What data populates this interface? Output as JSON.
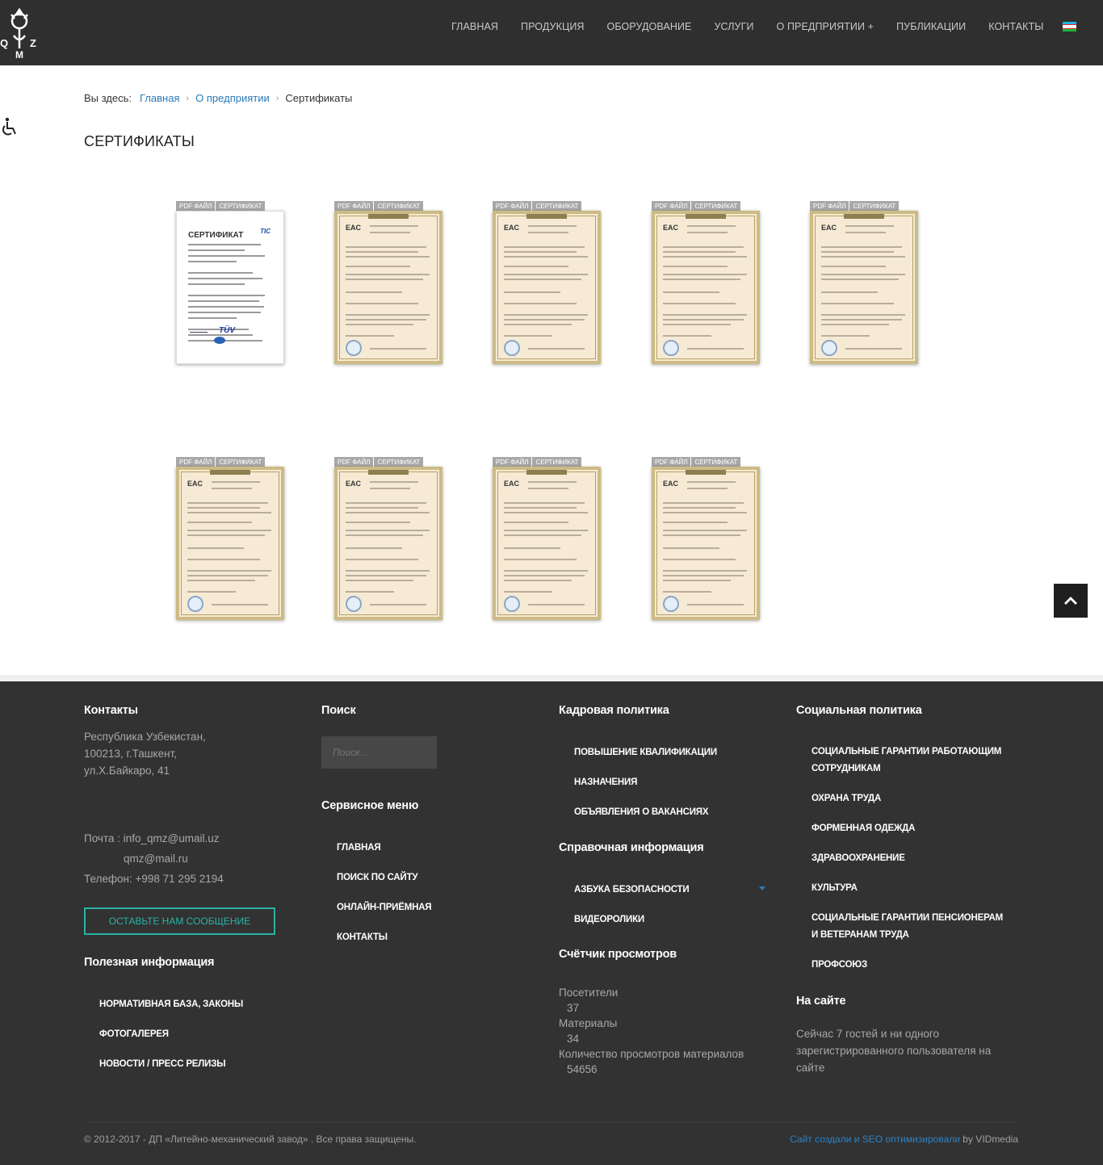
{
  "header": {
    "logo_letters": [
      "Q",
      "Z",
      "M"
    ],
    "nav": [
      "ГЛАВНАЯ",
      "ПРОДУКЦИЯ",
      "ОБОРУДОВАНИЕ",
      "УСЛУГИ",
      "О ПРЕДПРИЯТИИ +",
      "ПУБЛИКАЦИИ",
      "КОНТАКТЫ"
    ],
    "flag_icon": "uzbekistan-flag-icon"
  },
  "breadcrumb": {
    "label": "Вы здесь:",
    "items": [
      "Главная",
      "О предприятии",
      "Сертификаты"
    ],
    "separator": "›"
  },
  "page_title": "СЕРТИФИКАТЫ",
  "certificates": {
    "tag_pdf": "PDF ФАЙЛ",
    "tag_cert": "СЕРТИФИКАТ",
    "first_doc": {
      "title": "СЕРТИФИКАТ",
      "badge": "TIC",
      "logo": "TÜV"
    },
    "eac_label": "EAC",
    "count": 9
  },
  "footer": {
    "contacts": {
      "heading": "Контакты",
      "address": [
        "Республика Узбекистан,",
        "100213, г.Ташкент,",
        "ул.Х.Байкаро, 41"
      ],
      "mail_label": "Почта : info_qmz@umail.uz",
      "mail_second": "qmz@mail.ru",
      "phone": "Телефон: +998 71 295 2194",
      "button": "ОСТАВЬТЕ НАМ СООБЩЕНИЕ"
    },
    "useful": {
      "heading": "Полезная информация",
      "items": [
        "НОРМАТИВНАЯ БАЗА, ЗАКОНЫ",
        "ФОТОГАЛЕРЕЯ",
        "НОВОСТИ / ПРЕСС РЕЛИЗЫ"
      ]
    },
    "search": {
      "heading": "Поиск",
      "placeholder": "Поиск..."
    },
    "service": {
      "heading": "Сервисное меню",
      "items": [
        "ГЛАВНАЯ",
        "ПОИСК ПО САЙТУ",
        "ОНЛАЙН-ПРИЁМНАЯ",
        "КОНТАКТЫ"
      ]
    },
    "hr": {
      "heading": "Кадровая политика",
      "items": [
        "ПОВЫШЕНИЕ КВАЛИФИКАЦИИ",
        "НАЗНАЧЕНИЯ",
        "ОБЪЯВЛЕНИЯ О ВАКАНСИЯХ"
      ]
    },
    "reference": {
      "heading": "Справочная информация",
      "items": [
        "АЗБУКА БЕЗОПАСНОСТИ",
        "ВИДЕОРОЛИКИ"
      ]
    },
    "counter": {
      "heading": "Счётчик просмотров",
      "visitors_label": "Посетители",
      "visitors": "37",
      "materials_label": "Материалы",
      "materials": "34",
      "views_label": "Количество просмотров материалов",
      "views": "54656"
    },
    "social": {
      "heading": "Социальная политика",
      "items": [
        "СОЦИАЛЬНЫЕ ГАРАНТИИ РАБОТАЮЩИМ СОТРУДНИКАМ",
        "ОХРАНА ТРУДА",
        "ФОРМЕННАЯ ОДЕЖДА",
        "ЗДРАВООХРАНЕНИЕ",
        "КУЛЬТУРА",
        "СОЦИАЛЬНЫЕ ГАРАНТИИ ПЕНСИОНЕРАМ И ВЕТЕРАНАМ ТРУДА",
        "ПРОФСОЮЗ"
      ]
    },
    "online": {
      "heading": "На сайте",
      "text": "Сейчас 7 гостей и ни одного зарегистрированного пользователя на сайте"
    },
    "copyright": "© 2012-2017 - ДП «Литейно-механический завод» . Все права защищены.",
    "credit_link": "Сайт создали и SEO оптимизировали",
    "credit_by": " by VIDmedia"
  }
}
